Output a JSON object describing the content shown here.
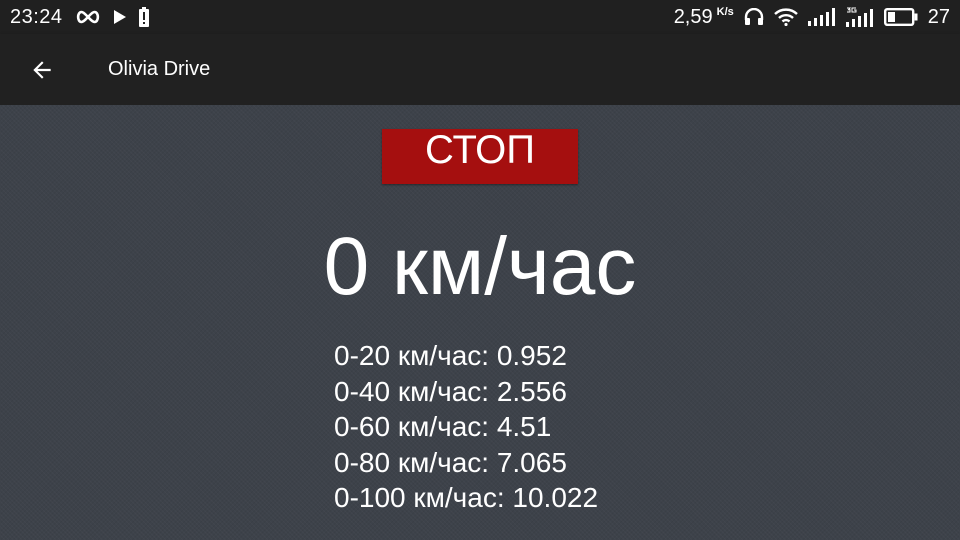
{
  "status_bar": {
    "time": "23:24",
    "net_speed": "2,59",
    "net_speed_unit": "K/s",
    "battery_percent": "27",
    "icons": [
      "infinity-icon",
      "play-icon",
      "battery-alert-icon",
      "headphones-icon",
      "wifi-icon",
      "signal-icon",
      "signal-3g-icon",
      "battery-icon"
    ]
  },
  "app_bar": {
    "title": "Olivia Drive",
    "back_icon": "arrow-back-icon"
  },
  "main": {
    "stop_label": "СТОП",
    "speed": "0 км/час",
    "results": [
      "0-20 км/час: 0.952",
      "0-40 км/час: 2.556",
      "0-60 км/час: 4.51",
      "0-80 км/час: 7.065",
      "0-100 км/час: 10.022"
    ]
  },
  "colors": {
    "background": "#3d424a",
    "toolbar": "#212121",
    "status_bar": "#202020",
    "stop_button": "#a50f0f",
    "text": "#ffffff"
  }
}
